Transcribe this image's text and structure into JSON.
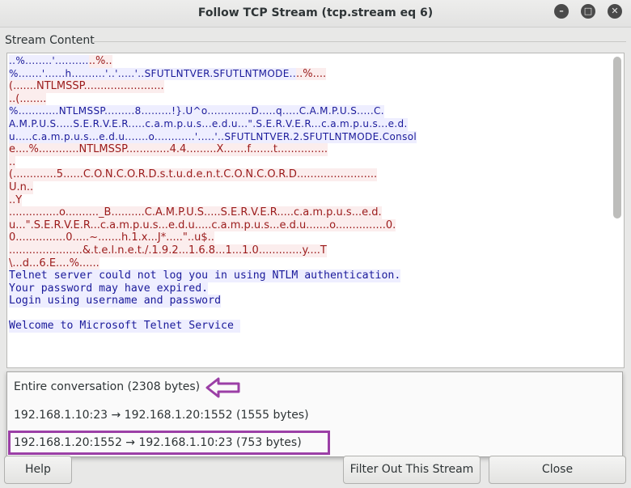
{
  "window": {
    "title": "Follow TCP Stream (tcp.stream eq 6)",
    "minimize_glyph": "–",
    "maximize_glyph": "□",
    "close_glyph": "✕"
  },
  "stream": {
    "label": "Stream Content",
    "client_color": "#1a1a9a",
    "client_bg": "#eeeeff",
    "server_color": "#9a1a1a",
    "server_bg": "#fbeded",
    "lines": [
      {
        "kind": "dots",
        "segs": [
          [
            "c",
            "..%........'.........."
          ],
          [
            "s",
            "..%.."
          ]
        ]
      },
      {
        "kind": "dots",
        "segs": [
          [
            "c",
            "%.......'......h..........'..'.....'..SFUTLNTVER.SFUTLNTMODE.."
          ],
          [
            "s",
            "..%...."
          ]
        ]
      },
      {
        "kind": "dots",
        "segs": [
          [
            "s",
            "(.......NTLMSSP........................"
          ]
        ]
      },
      {
        "kind": "dots",
        "segs": [
          [
            "s",
            "..(........"
          ]
        ]
      },
      {
        "kind": "dots",
        "segs": [
          [
            "c",
            "%............NTLMSSP.........8.........!}.U^o.............D.....q.....C.A.M.P.U.S.....C."
          ]
        ]
      },
      {
        "kind": "dots",
        "segs": [
          [
            "c",
            "A.M.P.U.S.....S.E.R.V.E.R.....c.a.m.p.u.s...e.d.u...\".S.E.R.V.E.R...c.a.m.p.u.s...e.d."
          ]
        ]
      },
      {
        "kind": "dots",
        "segs": [
          [
            "c",
            "u.....c.a.m.p.u.s...e.d.u.......o............'.....'..SFUTLNTVER.2.SFUTLNTMODE.Consol"
          ]
        ]
      },
      {
        "kind": "dots",
        "segs": [
          [
            "s",
            "e....%............NTLMSSP.............4.4.........X.......f.......t..............."
          ]
        ]
      },
      {
        "kind": "dots",
        "segs": [
          [
            "s",
            ".."
          ]
        ]
      },
      {
        "kind": "dots",
        "segs": [
          [
            "s",
            "(.............5......C.O.N.C.O.R.D.s.t.u.d.e.n.t.C.O.N.C.O.R.D........................"
          ]
        ]
      },
      {
        "kind": "dots",
        "segs": [
          [
            "s",
            "U.n.."
          ]
        ]
      },
      {
        "kind": "dots",
        "segs": [
          [
            "s",
            "..Y"
          ]
        ]
      },
      {
        "kind": "dots",
        "segs": [
          [
            "s",
            "...............o.........._B..........C.A.M.P.U.S.....S.E.R.V.E.R.....c.a.m.p.u.s...e.d."
          ]
        ]
      },
      {
        "kind": "dots",
        "segs": [
          [
            "s",
            "u...\".S.E.R.V.E.R...c.a.m.p.u.s...e.d.u.....c.a.m.p.u.s...e.d.u.......o...............0."
          ]
        ]
      },
      {
        "kind": "dots",
        "segs": [
          [
            "s",
            "0...............0.....~.......h.1.x...J*.....\"..u$.."
          ]
        ]
      },
      {
        "kind": "dots",
        "segs": [
          [
            "s",
            "......................&.t.e.l.n.e.t./.1.9.2...1.6.8...1...1.0.............y....T"
          ]
        ]
      },
      {
        "kind": "dots",
        "segs": [
          [
            "s",
            "\\...d...6.E....%......"
          ]
        ]
      },
      {
        "kind": "mono",
        "segs": [
          [
            "c",
            "Telnet server could not log you in using NTLM authentication."
          ]
        ]
      },
      {
        "kind": "mono",
        "segs": [
          [
            "c",
            "Your password may have expired."
          ]
        ]
      },
      {
        "kind": "mono",
        "segs": [
          [
            "c",
            "Login using username and password"
          ]
        ]
      },
      {
        "kind": "mono",
        "segs": [
          [
            "c",
            ""
          ]
        ]
      },
      {
        "kind": "mono",
        "segs": [
          [
            "c",
            "Welcome to Microsoft Telnet Service "
          ]
        ]
      }
    ]
  },
  "conversation_menu": {
    "highlight_color": "#9b3fa6",
    "selected_index": 2,
    "options": [
      "Entire conversation (2308 bytes)",
      "192.168.1.10:23 → 192.168.1.20:1552 (1555 bytes)",
      "192.168.1.20:1552 → 192.168.1.10:23 (753 bytes)"
    ]
  },
  "buttons": {
    "help": "Help",
    "filter_out": "Filter Out This Stream",
    "close": "Close"
  }
}
